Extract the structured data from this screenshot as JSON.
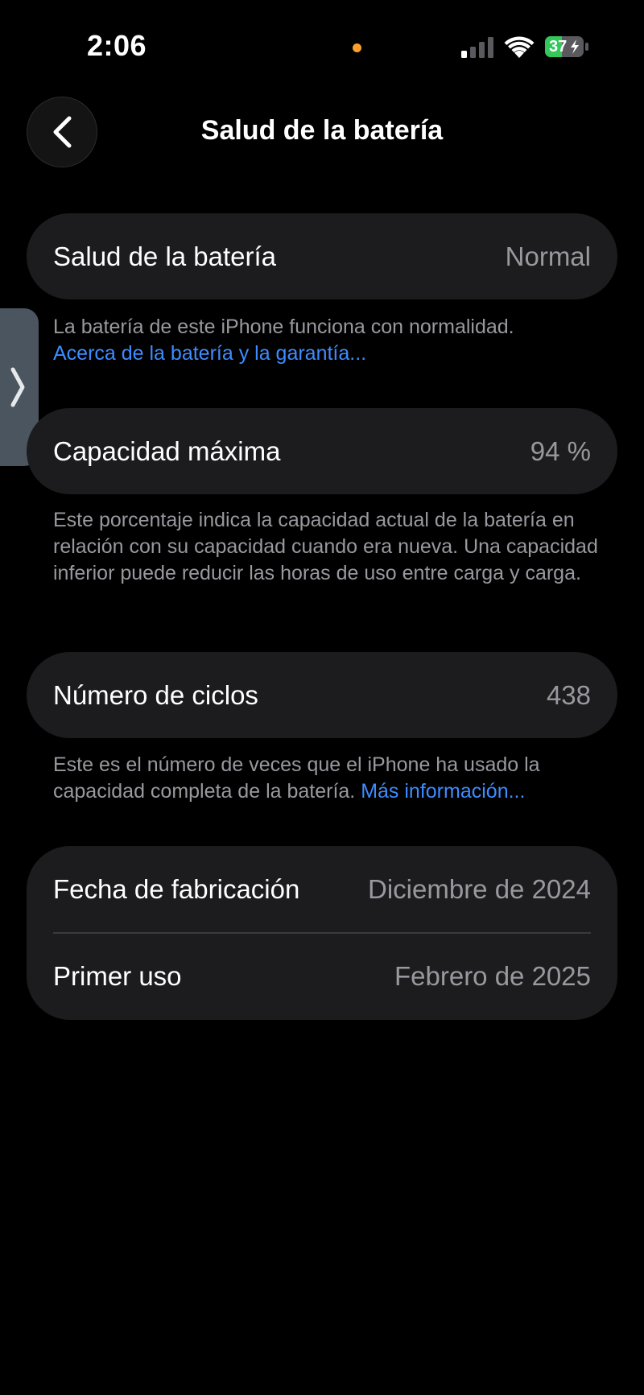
{
  "status_bar": {
    "time": "2:06",
    "battery_level": "37",
    "battery_color": "#34c759",
    "dot_color": "#ff9f2e"
  },
  "nav": {
    "title": "Salud de la batería"
  },
  "battery_health": {
    "label": "Salud de la batería",
    "value": "Normal",
    "footnote": "La batería de este iPhone funciona con normalidad.",
    "link": "Acerca de la batería y la garantía..."
  },
  "max_capacity": {
    "label": "Capacidad máxima",
    "value": "94 %",
    "footnote": "Este porcentaje indica la capacidad actual de la batería en relación con su capacidad cuando era nueva. Una capacidad inferior puede reducir las horas de uso entre carga y carga."
  },
  "cycle_count": {
    "label": "Número de ciclos",
    "value": "438",
    "footnote": "Este es el número de veces que el iPhone ha usado la capacidad completa de la batería.",
    "link": "Más información..."
  },
  "dates": {
    "manufacture_label": "Fecha de fabricación",
    "manufacture_value": "Diciembre de 2024",
    "first_use_label": "Primer uso",
    "first_use_value": "Febrero de 2025"
  }
}
